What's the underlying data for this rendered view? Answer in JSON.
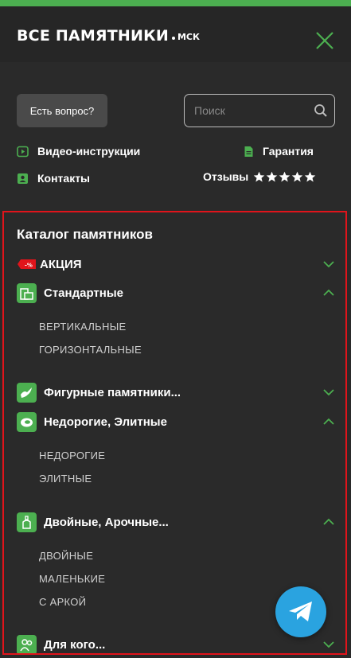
{
  "header": {
    "logo_text": "ВСЕ ПАМЯТНИКИ",
    "logo_city": "МСК"
  },
  "actions": {
    "ask_label": "Есть вопрос?",
    "search_placeholder": "Поиск"
  },
  "links": {
    "video": "Видео-инструкции",
    "warranty": "Гарантия",
    "contacts": "Контакты",
    "reviews": "Отзывы",
    "rating_stars": 5
  },
  "catalog": {
    "title": "Каталог памятников",
    "sale": "АКЦИЯ",
    "sale_badge": "-%",
    "standard": "Стандартные",
    "standard_sub": [
      "ВЕРТИКАЛЬНЫЕ",
      "ГОРИЗОНТАЛЬНЫЕ"
    ],
    "figured": "Фигурные памятники...",
    "cheap_elite": "Недорогие, Элитные",
    "cheap_elite_sub": [
      "НЕДОРОГИЕ",
      "ЭЛИТНЫЕ"
    ],
    "double_arched": "Двойные, Арочные...",
    "double_arched_sub": [
      "ДВОЙНЫЕ",
      "МАЛЕНЬКИЕ",
      "С АРКОЙ"
    ],
    "for_whom": "Для кого..."
  },
  "colors": {
    "accent": "#4caf50",
    "background": "#2a2a2a",
    "header": "#262626",
    "highlight_border": "#e0141b",
    "telegram": "#2aa3e0"
  }
}
